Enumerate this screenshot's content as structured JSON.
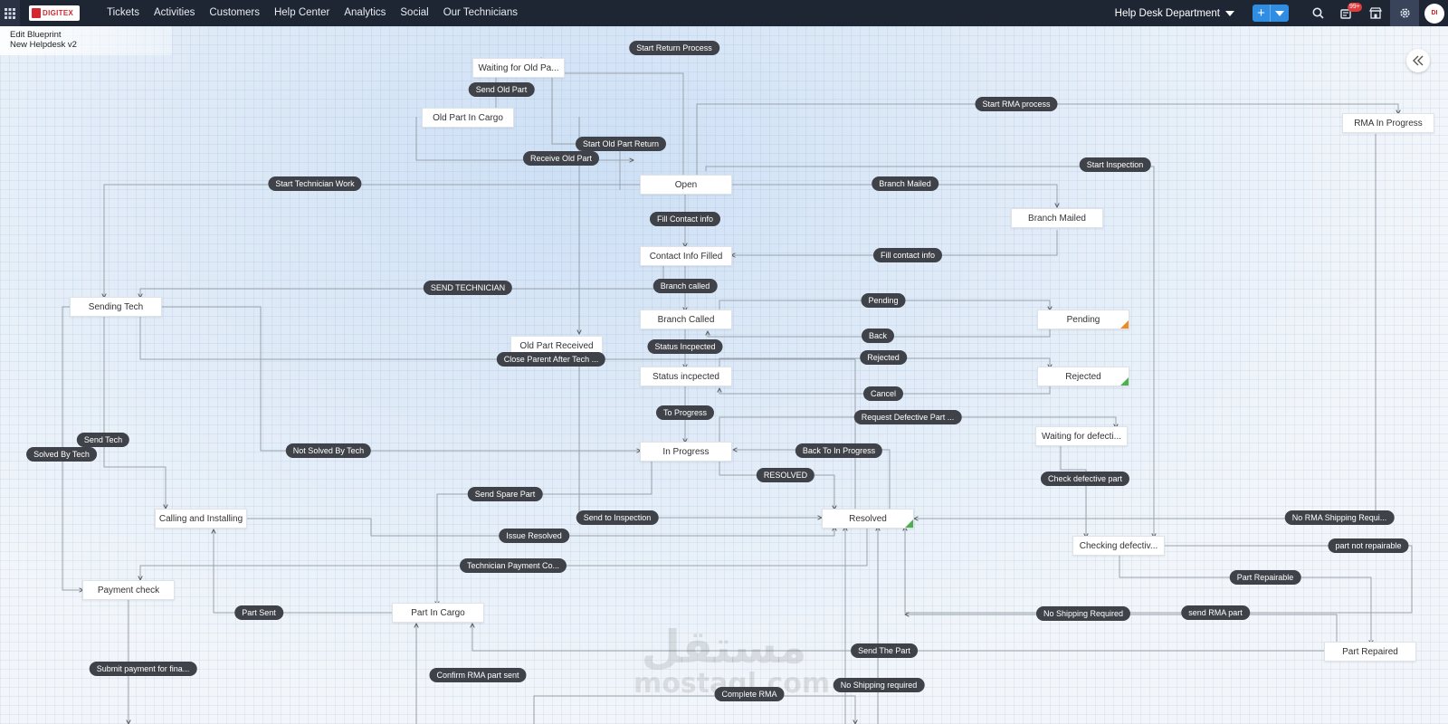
{
  "topbar": {
    "logo_text": "DIGITEX",
    "nav": [
      "Tickets",
      "Activities",
      "Customers",
      "Help Center",
      "Analytics",
      "Social",
      "Our Technicians"
    ],
    "department": "Help Desk Department",
    "notification_count": "99+",
    "add_label": "+",
    "avatar_text": "DI"
  },
  "breadcrumb": {
    "line1": "Edit Blueprint",
    "line2": "New Helpdesk v2"
  },
  "states": {
    "waiting_old_part": "Waiting for Old Pa...",
    "old_part_cargo": "Old Part In Cargo",
    "open": "Open",
    "contact_info_filled": "Contact Info Filled",
    "branch_mailed": "Branch Mailed",
    "rma_in_progress": "RMA In Progress",
    "sending_tech": "Sending Tech",
    "branch_called": "Branch Called",
    "pending": "Pending",
    "old_part_received": "Old Part Received",
    "status_incpected": "Status incpected",
    "rejected": "Rejected",
    "waiting_defective": "Waiting for defecti...",
    "in_progress": "In Progress",
    "calling_installing": "Calling and Installing",
    "resolved": "Resolved",
    "checking_defective": "Checking defectiv...",
    "payment_check": "Payment check",
    "part_in_cargo": "Part In Cargo",
    "part_repaired": "Part Repaired"
  },
  "transitions": {
    "start_return_process": "Start Return Process",
    "send_old_part": "Send Old Part",
    "start_rma_process": "Start RMA process",
    "start_old_part_return": "Start Old Part Return",
    "receive_old_part": "Receive Old Part",
    "start_inspection": "Start Inspection",
    "start_technician_work": "Start Technician Work",
    "branch_mailed": "Branch Mailed",
    "fill_contact_info_upper": "Fill Contact info",
    "fill_contact_info_lower": "Fill contact info",
    "send_technician": "SEND TECHNICIAN",
    "branch_called": "Branch called",
    "pending": "Pending",
    "status_incpected": "Status Incpected",
    "back": "Back",
    "close_parent": "Close Parent After Tech ...",
    "rejected": "Rejected",
    "cancel": "Cancel",
    "to_progress": "To Progress",
    "request_defective": "Request Defective Part ...",
    "send_tech": "Send Tech",
    "solved_by_tech": "Solved By Tech",
    "not_solved_by_tech": "Not Solved By Tech",
    "back_to_in_progress": "Back To In Progress",
    "resolved": "RESOLVED",
    "check_defective": "Check defective part",
    "send_spare_part": "Send Spare Part",
    "send_to_inspection": "Send to Inspection",
    "no_rma_shipping": "No RMA Shipping Requi...",
    "issue_resolved": "Issue Resolved",
    "part_not_repairable": "part not repairable",
    "technician_payment": "Technician Payment Co...",
    "part_repairable": "Part Repairable",
    "part_sent": "Part Sent",
    "no_shipping_required": "No Shipping Required",
    "send_rma_part": "send RMA part",
    "send_the_part": "Send The Part",
    "submit_payment": "Submit payment for fina...",
    "confirm_rma_part_sent": "Confirm RMA part sent",
    "no_shipping_required_lower": "No Shipping required",
    "complete_rma": "Complete RMA"
  },
  "watermark": {
    "arabic": "مستقل",
    "latin": "mostaql.com"
  },
  "colors": {
    "topbar_bg": "#1e2533",
    "accent_blue": "#2f8de4",
    "pill_bg": "#3f4349",
    "resolved_corner": "#4caf50",
    "pending_corner": "#f08a24"
  },
  "icons": [
    "apps-grid-icon",
    "search-icon",
    "notifications-icon",
    "store-icon",
    "settings-icon",
    "collapse-panel-icon"
  ]
}
